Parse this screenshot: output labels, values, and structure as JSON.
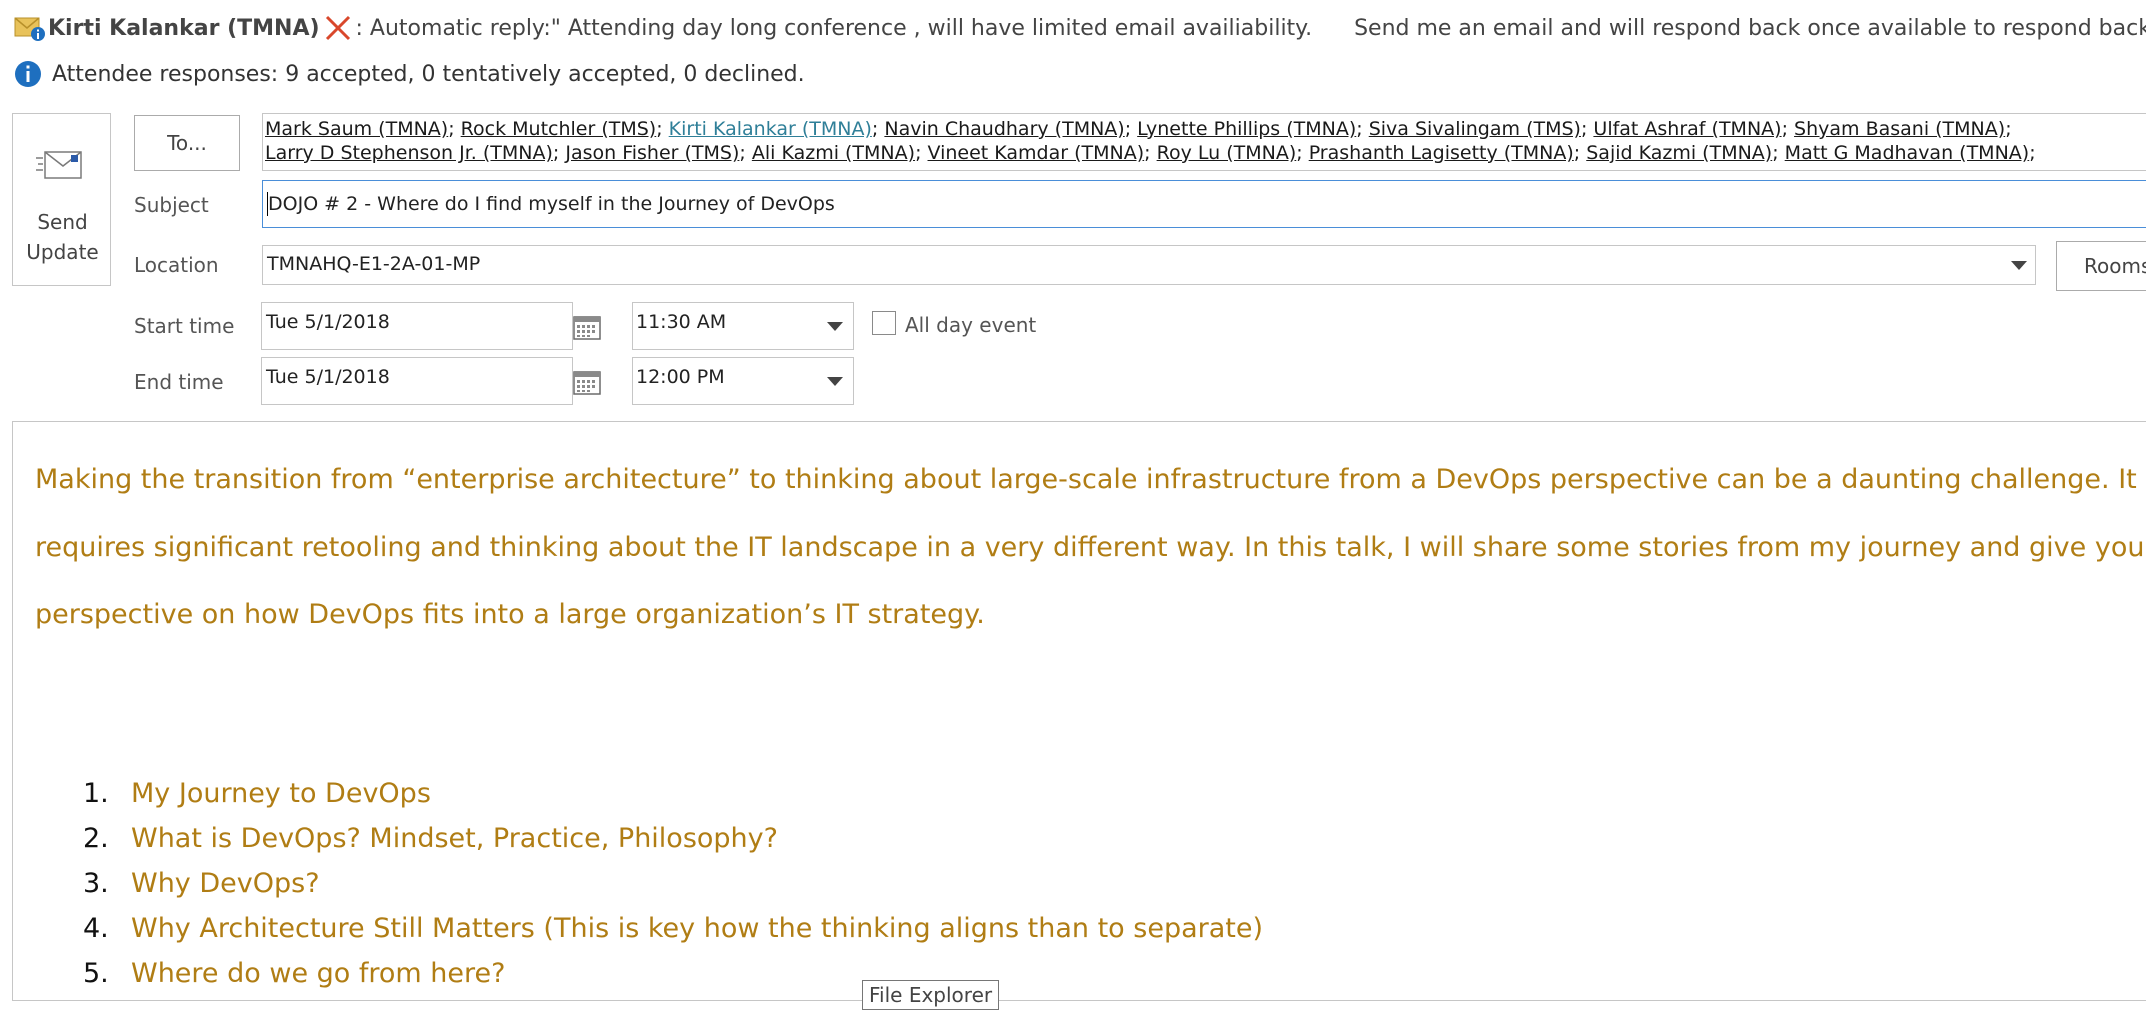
{
  "auto_reply": {
    "sender": "Kirti Kalankar (TMNA)",
    "text1": ": Automatic reply:\"   Attending day long conference , will have limited email availiability.",
    "text2": "Send me an email and will respond back once available to respond back.\""
  },
  "attendee_responses": "Attendee responses: 9 accepted, 0 tentatively accepted, 0 declined.",
  "send_update": {
    "line1": "Send",
    "line2": "Update"
  },
  "to_button": "To...",
  "recipients_line1": [
    "Mark Saum (TMNA)",
    "Rock Mutchler (TMS)",
    "Kirti Kalankar (TMNA)",
    "Navin Chaudhary (TMNA)",
    "Lynette Phillips (TMNA)",
    "Siva Sivalingam (TMS)",
    "Ulfat Ashraf (TMNA)",
    "Shyam Basani (TMNA)"
  ],
  "recipients_line2": [
    "Larry D Stephenson Jr. (TMNA)",
    "Jason Fisher (TMS)",
    "Ali Kazmi (TMNA)",
    "Vineet Kamdar (TMNA)",
    "Roy Lu (TMNA)",
    "Prashanth Lagisetty (TMNA)",
    "Sajid Kazmi (TMNA)",
    "Matt G Madhavan (TMNA)"
  ],
  "highlighted_recipient": "Kirti Kalankar (TMNA)",
  "labels": {
    "subject": "Subject",
    "location": "Location",
    "start_time": "Start time",
    "end_time": "End time",
    "all_day": "All day event",
    "rooms": "Rooms"
  },
  "subject": "DOJO # 2 - Where do I find myself in the Journey of DevOps",
  "location": "TMNAHQ-E1-2A-01-MP",
  "start_date": "Tue 5/1/2018",
  "start_time": "11:30 AM",
  "end_date": "Tue 5/1/2018",
  "end_time": "12:00 PM",
  "all_day_checked": false,
  "body_paragraph": [
    "Making the transition from “enterprise architecture” to thinking about large-scale infrastructure from a DevOps perspective can be a daunting challenge.  It",
    "requires significant retooling and thinking about the IT landscape in a very different way.  In this talk, I will share some stories from my journey and give you my",
    "perspective on how DevOps fits into a large organization’s IT strategy."
  ],
  "agenda": [
    {
      "num": "1.",
      "text": "My Journey to DevOps"
    },
    {
      "num": "2.",
      "text": "What is DevOps? Mindset, Practice, Philosophy?"
    },
    {
      "num": "3.",
      "text": "Why DevOps?"
    },
    {
      "num": "4.",
      "text": "Why Architecture Still Matters (This is key how the thinking aligns than to separate)"
    },
    {
      "num": "5.",
      "text": "Where do we go from here?"
    }
  ],
  "tooltip": "File Explorer",
  "colors": {
    "body_text": "#b07d14",
    "link": "#2f7f98",
    "accent_border": "#4a8ed8",
    "error_x": "#d9472b",
    "info_blue": "#1e6fbf"
  }
}
